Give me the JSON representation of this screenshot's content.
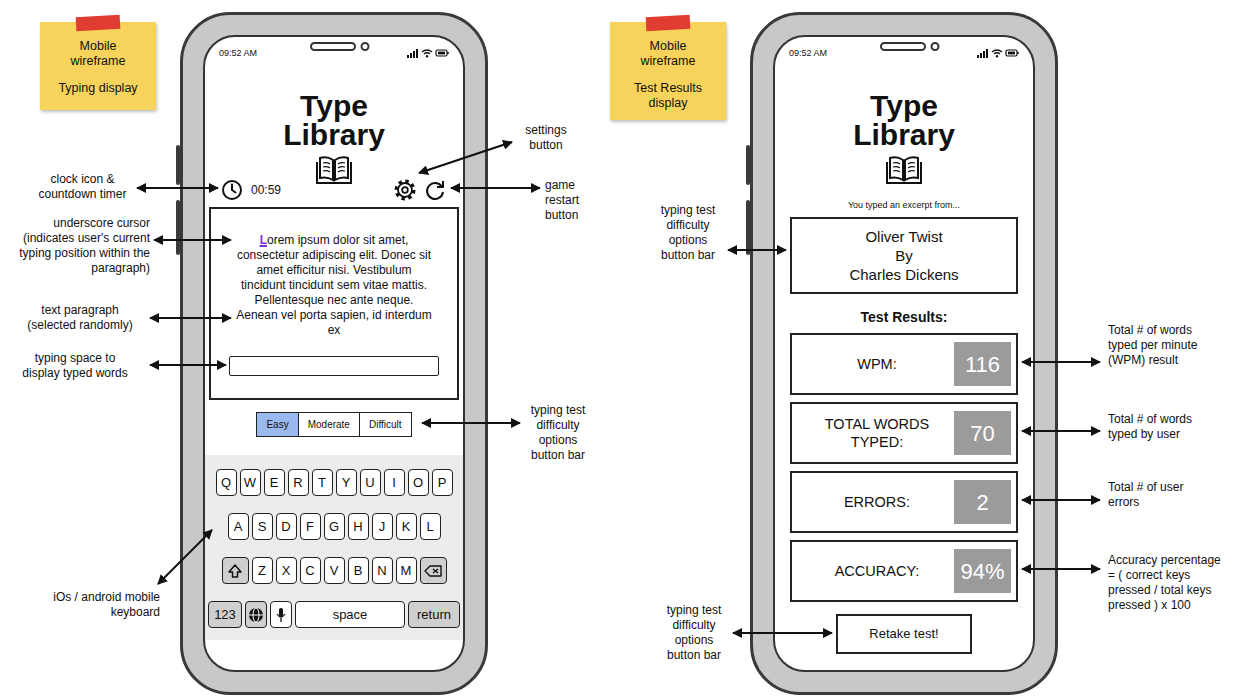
{
  "notes": [
    {
      "lines": [
        "Mobile",
        "wireframe"
      ],
      "caption_lines": [
        "Typing display"
      ]
    },
    {
      "lines": [
        "Mobile",
        "wireframe"
      ],
      "caption_lines": [
        "Test Results",
        "display"
      ]
    }
  ],
  "typing_screen": {
    "time": "09:52 AM",
    "title_lines": [
      "Type",
      "Library"
    ],
    "timer": "00:59",
    "paragraph": "Lorem ipsum dolor sit amet, consectetur adipiscing elit. Donec sit amet efficitur nisi. Vestibulum tincidunt tincidunt sem vitae mattis. Pellentesque nec ante neque. Aenean vel porta sapien, id interdum ex",
    "cursor": 0,
    "difficulty": [
      {
        "label": "Easy",
        "selected": true
      },
      {
        "label": "Moderate",
        "selected": false
      },
      {
        "label": "Difficult",
        "selected": false
      }
    ],
    "keyboard": {
      "rows": [
        [
          "Q",
          "W",
          "E",
          "R",
          "T",
          "Y",
          "U",
          "I",
          "O",
          "P"
        ],
        [
          "A",
          "S",
          "D",
          "F",
          "G",
          "H",
          "J",
          "K",
          "L"
        ],
        [
          "Z",
          "X",
          "C",
          "V",
          "B",
          "N",
          "M"
        ]
      ],
      "numbers": "123",
      "space": "space",
      "return": "return"
    }
  },
  "results_screen": {
    "time": "09:52 AM",
    "title_lines": [
      "Type",
      "Library"
    ],
    "intro": "You typed an excerpt from...",
    "book_lines": [
      "Oliver Twist",
      "By",
      "Charles Dickens"
    ],
    "heading": "Test Results:",
    "results": [
      {
        "label_lines": [
          "WPM:"
        ],
        "value": "116"
      },
      {
        "label_lines": [
          "TOTAL WORDS",
          "TYPED:"
        ],
        "value": "70"
      },
      {
        "label_lines": [
          "ERRORS:"
        ],
        "value": "2"
      },
      {
        "label_lines": [
          "ACCURACY:"
        ],
        "value": "94%"
      }
    ],
    "button": "Retake test!"
  },
  "annotations": [
    {
      "lines": [
        "clock icon &",
        "countdown timer"
      ]
    },
    {
      "lines": [
        "underscore cursor",
        "(indicates user's current",
        "typing position within the",
        "paragraph)"
      ]
    },
    {
      "lines": [
        "text paragraph",
        "(selected randomly)"
      ]
    },
    {
      "lines": [
        "typing space to",
        "display typed words"
      ]
    },
    {
      "lines": [
        "iOs / android mobile",
        "keyboard"
      ]
    },
    {
      "lines": [
        "settings",
        "button"
      ]
    },
    {
      "lines": [
        "game",
        "restart",
        "button"
      ]
    },
    {
      "lines": [
        "typing test",
        "difficulty",
        "options",
        "button bar"
      ]
    },
    {
      "lines": [
        "typing test",
        "difficulty",
        "options",
        "button bar"
      ]
    },
    {
      "lines": [
        "typing test",
        "difficulty",
        "options",
        "button bar"
      ]
    },
    {
      "lines": [
        "Total # of words",
        "typed per minute",
        "(WPM) result"
      ]
    },
    {
      "lines": [
        "Total # of words",
        "typed by user"
      ]
    },
    {
      "lines": [
        "Total # of user",
        "errors"
      ]
    },
    {
      "lines": [
        "Accuracy percentage",
        "= ( correct keys",
        "pressed / total keys",
        "pressed ) x 100"
      ]
    }
  ]
}
